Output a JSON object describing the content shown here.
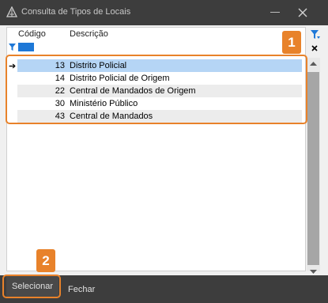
{
  "window": {
    "title": "Consulta de Tipos de Locais",
    "minimize_icon": "minimize-icon",
    "close_icon": "close-icon"
  },
  "grid": {
    "columns": [
      "Código",
      "Descrição"
    ],
    "rows": [
      {
        "code": "13",
        "description": "Distrito Policial",
        "selected": true
      },
      {
        "code": "14",
        "description": "Distrito Policial de Origem",
        "selected": false
      },
      {
        "code": "22",
        "description": "Central de Mandados de Origem",
        "selected": false
      },
      {
        "code": "30",
        "description": "Ministério Público",
        "selected": false
      },
      {
        "code": "43",
        "description": "Central de Mandados",
        "selected": false
      }
    ],
    "selected_color": "#b5d5f5",
    "alt_row_color": "#ececec"
  },
  "annotations": {
    "badge1": "1",
    "badge2": "2",
    "color": "#e8822a"
  },
  "footer": {
    "select_label": "Selecionar",
    "close_label": "Fechar"
  }
}
